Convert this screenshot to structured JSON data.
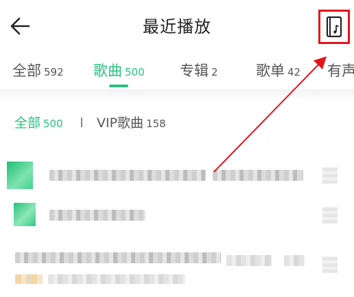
{
  "header": {
    "title": "最近播放",
    "back_icon": "arrow-left-icon",
    "action_icon": "ringtone-icon",
    "highlight_color": "#e4141b"
  },
  "tabs": [
    {
      "label": "全部",
      "count": "592",
      "active": false
    },
    {
      "label": "歌曲",
      "count": "500",
      "active": true
    },
    {
      "label": "专辑",
      "count": "2",
      "active": false
    },
    {
      "label": "歌单",
      "count": "42",
      "active": false
    },
    {
      "label": "有声",
      "count": "",
      "active": false
    }
  ],
  "filters": [
    {
      "label": "全部",
      "count": "500",
      "active": true
    },
    {
      "label": "VIP歌曲",
      "count": "158",
      "active": false
    }
  ],
  "colors": {
    "accent": "#27c17e",
    "annotation_red": "#e4141b",
    "text_primary": "#222222",
    "text_secondary": "#555555"
  }
}
